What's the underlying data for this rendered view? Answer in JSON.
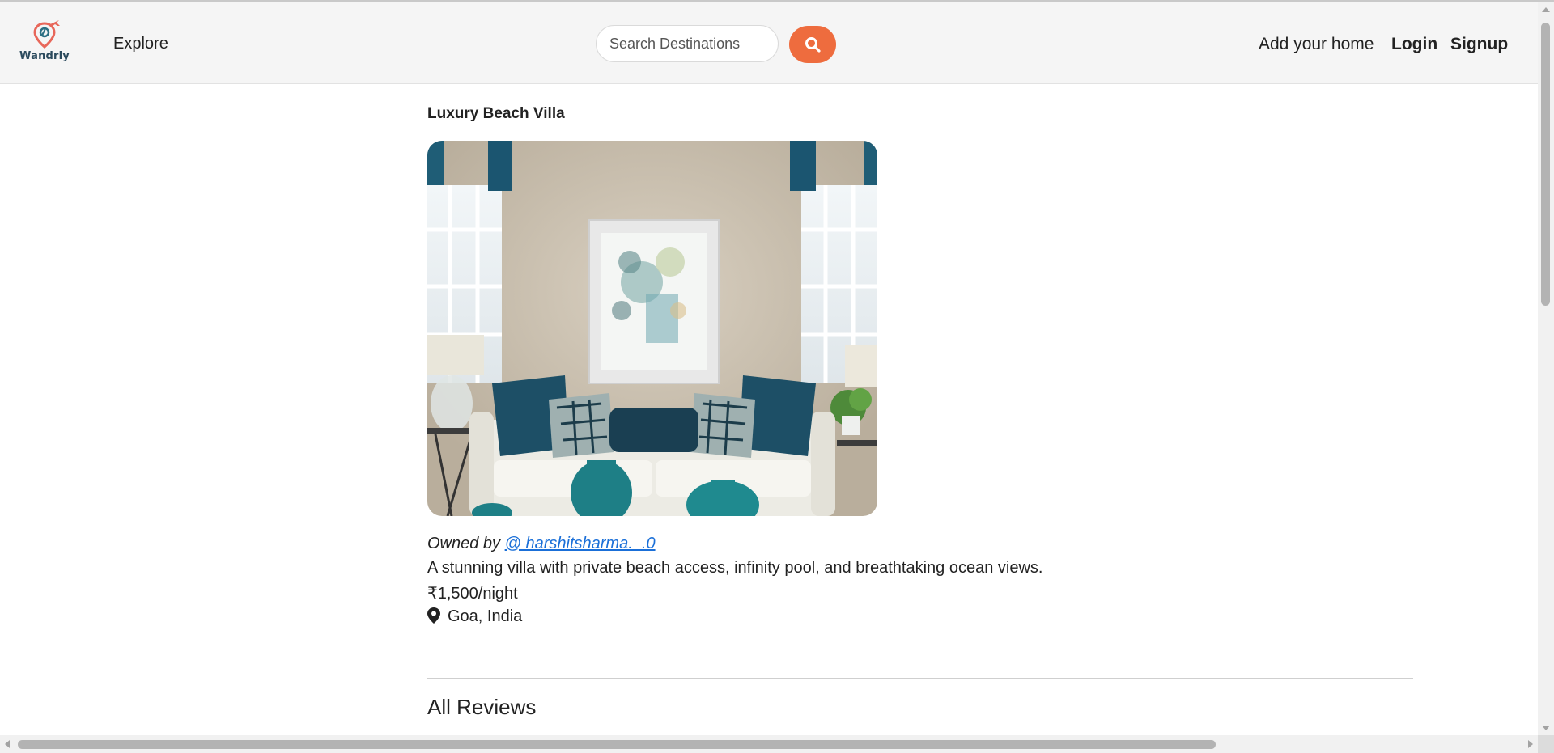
{
  "navbar": {
    "logo_text": "Wandrly",
    "logo_icon": "map-pin-airplane-icon",
    "explore_label": "Explore",
    "search_placeholder": "Search Destinations",
    "search_icon": "search-icon",
    "add_home_label": "Add your home",
    "login_label": "Login",
    "signup_label": "Signup"
  },
  "listing": {
    "title": "Luxury Beach Villa",
    "image_icon": "listing-photo",
    "owner_prefix": "Owned by",
    "owner_handle": "@ harshitsharma._.0",
    "description": "A stunning villa with private beach access, infinity pool, and breathtaking ocean views.",
    "price": "₹1,500/night",
    "location_icon": "location-pin-icon",
    "location": "Goa, India"
  },
  "reviews": {
    "heading": "All Reviews"
  },
  "colors": {
    "accent": "#ee6c3e",
    "link": "#1a6fd8",
    "navbar_bg": "#f5f5f5",
    "text": "#222222",
    "logo_teal": "#2b6f83"
  }
}
